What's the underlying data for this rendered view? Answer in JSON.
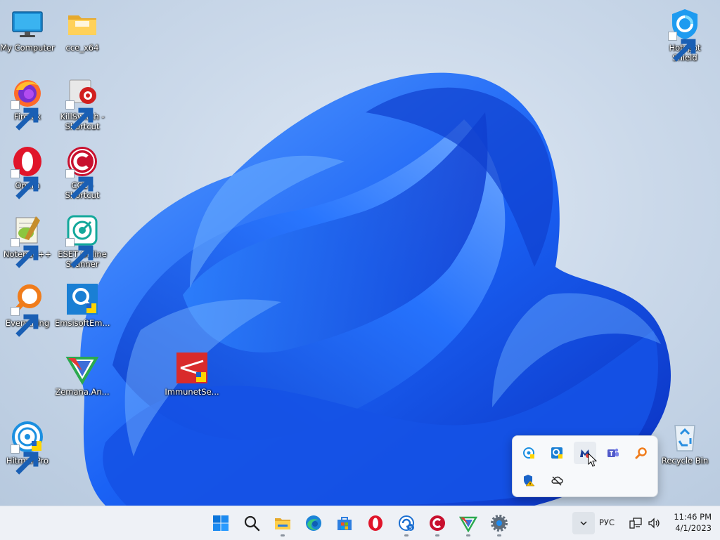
{
  "desktop": {
    "icons": [
      {
        "key": "my-computer",
        "label": "My Computer"
      },
      {
        "key": "cce-x64",
        "label": "cce_x64"
      },
      {
        "key": "hotspot-shield",
        "label": "Hotspot\nShield"
      },
      {
        "key": "firefox",
        "label": "Firefox"
      },
      {
        "key": "killswitch",
        "label": "KillSwitch -\nShortcut"
      },
      {
        "key": "opera",
        "label": "Opera"
      },
      {
        "key": "cce",
        "label": "CCE -\nShortcut"
      },
      {
        "key": "notepadpp",
        "label": "Notepad++"
      },
      {
        "key": "eset",
        "label": "ESET Online\nScanner"
      },
      {
        "key": "everything",
        "label": "Everything"
      },
      {
        "key": "emsisoft",
        "label": "EmsisoftEm..."
      },
      {
        "key": "zemana",
        "label": "Zemana.An..."
      },
      {
        "key": "immunet",
        "label": "ImmunetSe..."
      },
      {
        "key": "hitmanpro",
        "label": "HitmanPro"
      },
      {
        "key": "recycle-bin",
        "label": "Recycle Bin"
      }
    ]
  },
  "tray_popup": {
    "icons": [
      "hitmanpro-tray-icon",
      "emsisoft-tray-icon",
      "malwarebytes-tray-icon",
      "teams-tray-icon",
      "everything-tray-icon",
      "security-warning-icon",
      "onedrive-offline-icon"
    ]
  },
  "taskbar": {
    "apps": [
      "start-icon",
      "search-icon",
      "file-explorer-icon",
      "edge-icon",
      "store-icon",
      "opera-icon",
      "cce-icon",
      "cce-tool-icon",
      "zemana-icon",
      "settings-icon"
    ],
    "language": "РУС",
    "time": "11:46 PM",
    "date": "4/1/2023"
  },
  "colors": {
    "taskbar_bg": "#eef1f6",
    "wallpaper_blue": "#1f6bff",
    "accent": "#0067c0"
  }
}
